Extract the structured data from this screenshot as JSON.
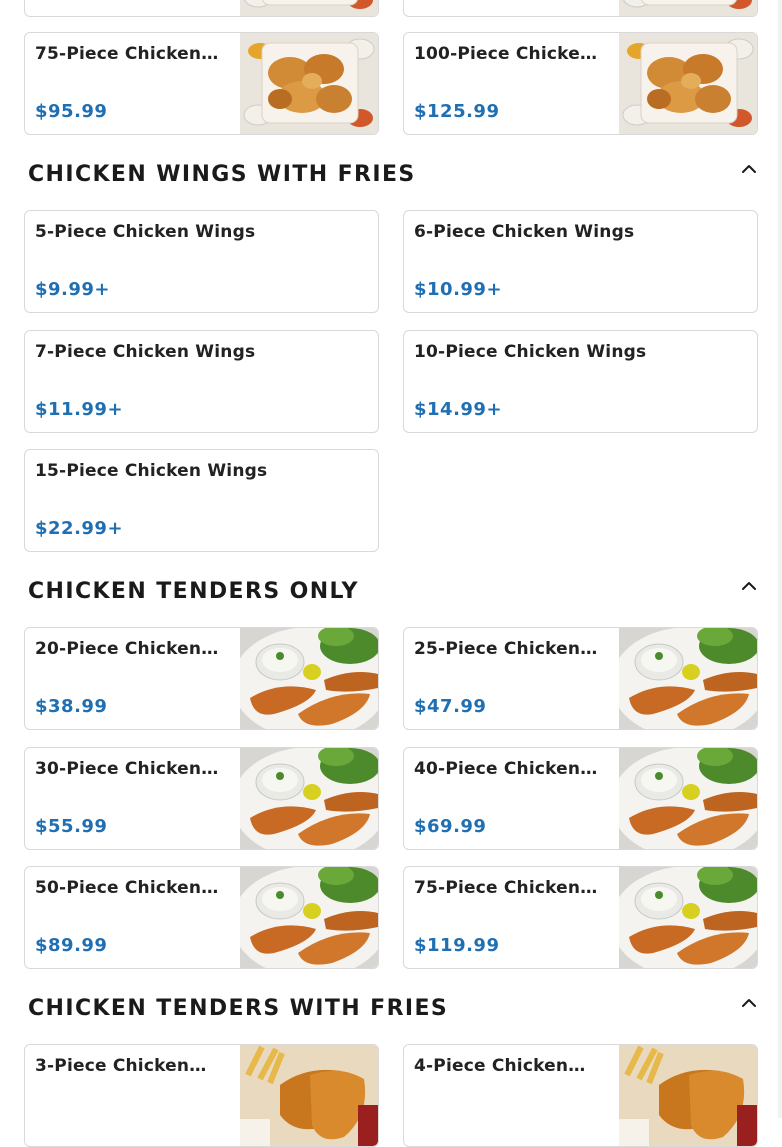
{
  "colors": {
    "price": "#1f6fb2",
    "border": "#d9d9d9",
    "title": "#1a1a1a"
  },
  "icons": {
    "collapse": "chevron-up-icon"
  },
  "top_partial": [
    {
      "name": "",
      "price": "",
      "image": "chicken-pieces-tray-photo"
    },
    {
      "name": "",
      "price": "",
      "image": "chicken-pieces-tray-photo"
    }
  ],
  "top_items": [
    {
      "name": "75-Piece Chicken…",
      "price": "$95.99",
      "image": "chicken-pieces-tray-photo"
    },
    {
      "name": "100-Piece Chicken…",
      "price": "$125.99",
      "image": "chicken-pieces-tray-photo"
    }
  ],
  "sections": [
    {
      "title": "CHICKEN WINGS WITH FRIES",
      "items": [
        {
          "name": "5-Piece Chicken Wings",
          "price": "$9.99+"
        },
        {
          "name": "6-Piece Chicken Wings",
          "price": "$10.99+"
        },
        {
          "name": "7-Piece Chicken Wings",
          "price": "$11.99+"
        },
        {
          "name": "10-Piece Chicken Wings",
          "price": "$14.99+"
        },
        {
          "name": "15-Piece Chicken Wings",
          "price": "$22.99+"
        }
      ]
    },
    {
      "title": "CHICKEN TENDERS ONLY",
      "items": [
        {
          "name": "20-Piece Chicken…",
          "price": "$38.99",
          "image": "chicken-tenders-plate-photo"
        },
        {
          "name": "25-Piece Chicken…",
          "price": "$47.99",
          "image": "chicken-tenders-plate-photo"
        },
        {
          "name": "30-Piece Chicken…",
          "price": "$55.99",
          "image": "chicken-tenders-plate-photo"
        },
        {
          "name": "40-Piece Chicken…",
          "price": "$69.99",
          "image": "chicken-tenders-plate-photo"
        },
        {
          "name": "50-Piece Chicken…",
          "price": "$89.99",
          "image": "chicken-tenders-plate-photo"
        },
        {
          "name": "75-Piece Chicken…",
          "price": "$119.99",
          "image": "chicken-tenders-plate-photo"
        }
      ]
    },
    {
      "title": "CHICKEN TENDERS WITH FRIES",
      "items": [
        {
          "name": "3-Piece Chicken…",
          "price": "",
          "image": "tenders-with-fries-photo"
        },
        {
          "name": "4-Piece Chicken…",
          "price": "",
          "image": "tenders-with-fries-photo"
        }
      ]
    }
  ]
}
